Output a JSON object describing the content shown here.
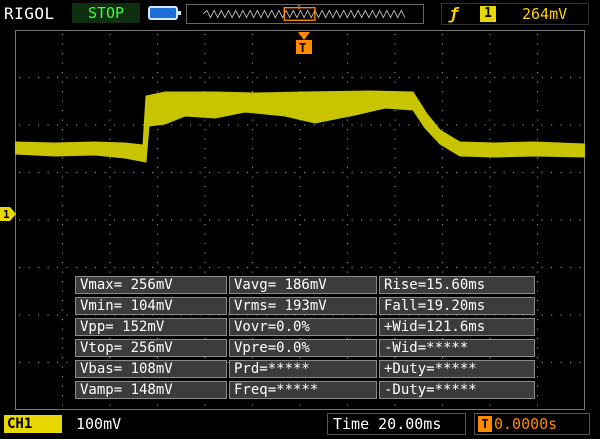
{
  "header": {
    "brand": "RIGOL",
    "run_state": "STOP",
    "trigger_source": "1",
    "trigger_level": "264mV"
  },
  "channel": {
    "marker": "1",
    "tag": "CH1",
    "scale": "100mV"
  },
  "timebase": {
    "label": "Time 20.00ms",
    "offset": "0.0000s",
    "trigger_marker": "T"
  },
  "measurements": {
    "rows": [
      [
        "Vmax= 256mV",
        "Vavg= 186mV",
        "Rise=15.60ms"
      ],
      [
        "Vmin= 104mV",
        "Vrms= 193mV",
        "Fall=19.20ms"
      ],
      [
        "Vpp= 152mV",
        "Vovr=0.0%",
        "+Wid=121.6ms"
      ],
      [
        "Vtop= 256mV",
        "Vpre=0.0%",
        "-Wid=*****"
      ],
      [
        "Vbas= 108mV",
        "Prd=*****",
        "+Duty=*****"
      ],
      [
        "Vamp= 148mV",
        "Freq=*****",
        "-Duty=*****"
      ]
    ]
  },
  "colors": {
    "trace": "#c8c400",
    "channel": "#e8d800",
    "trigger": "#ff8a00",
    "run_state": "#3cff3c"
  }
}
